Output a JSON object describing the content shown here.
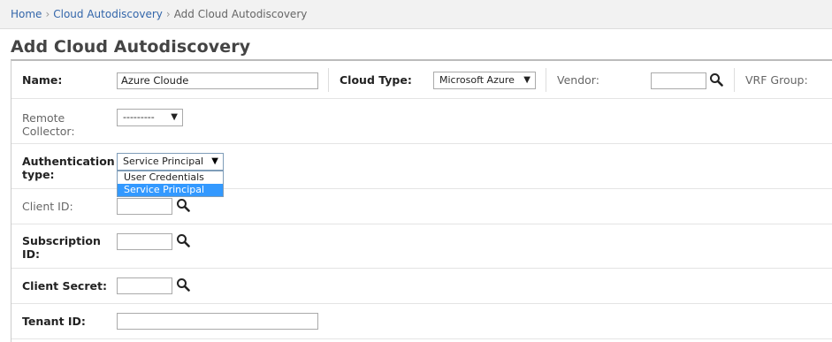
{
  "breadcrumb": {
    "home": "Home",
    "parent": "Cloud Autodiscovery",
    "current": "Add Cloud Autodiscovery",
    "separator": "›"
  },
  "page_title": "Add Cloud Autodiscovery",
  "form": {
    "name_label": "Name:",
    "name_value": "Azure Cloude",
    "cloud_type_label": "Cloud Type:",
    "cloud_type_value": "Microsoft Azure",
    "vendor_label": "Vendor:",
    "vendor_value": "",
    "vrf_group_label": "VRF Group:",
    "remote_collector_label_1": "Remote",
    "remote_collector_label_2": "Collector:",
    "remote_collector_value": "---------",
    "auth_type_label_1": "Authentication",
    "auth_type_label_2": "type:",
    "auth_type_value": "Service Principal",
    "auth_type_options": [
      "User Credentials",
      "Service Principal"
    ],
    "client_id_label": "Client ID:",
    "client_id_value": "",
    "subscription_id_label_1": "Subscription",
    "subscription_id_label_2": "ID:",
    "subscription_id_value": "",
    "client_secret_label": "Client Secret:",
    "client_secret_value": "",
    "tenant_id_label": "Tenant ID:",
    "tenant_id_value": ""
  },
  "icons": {
    "lookup": "search-icon",
    "dropdown": "chevron-down-icon"
  },
  "colors": {
    "link": "#3366aa",
    "highlight": "#3399ff"
  }
}
